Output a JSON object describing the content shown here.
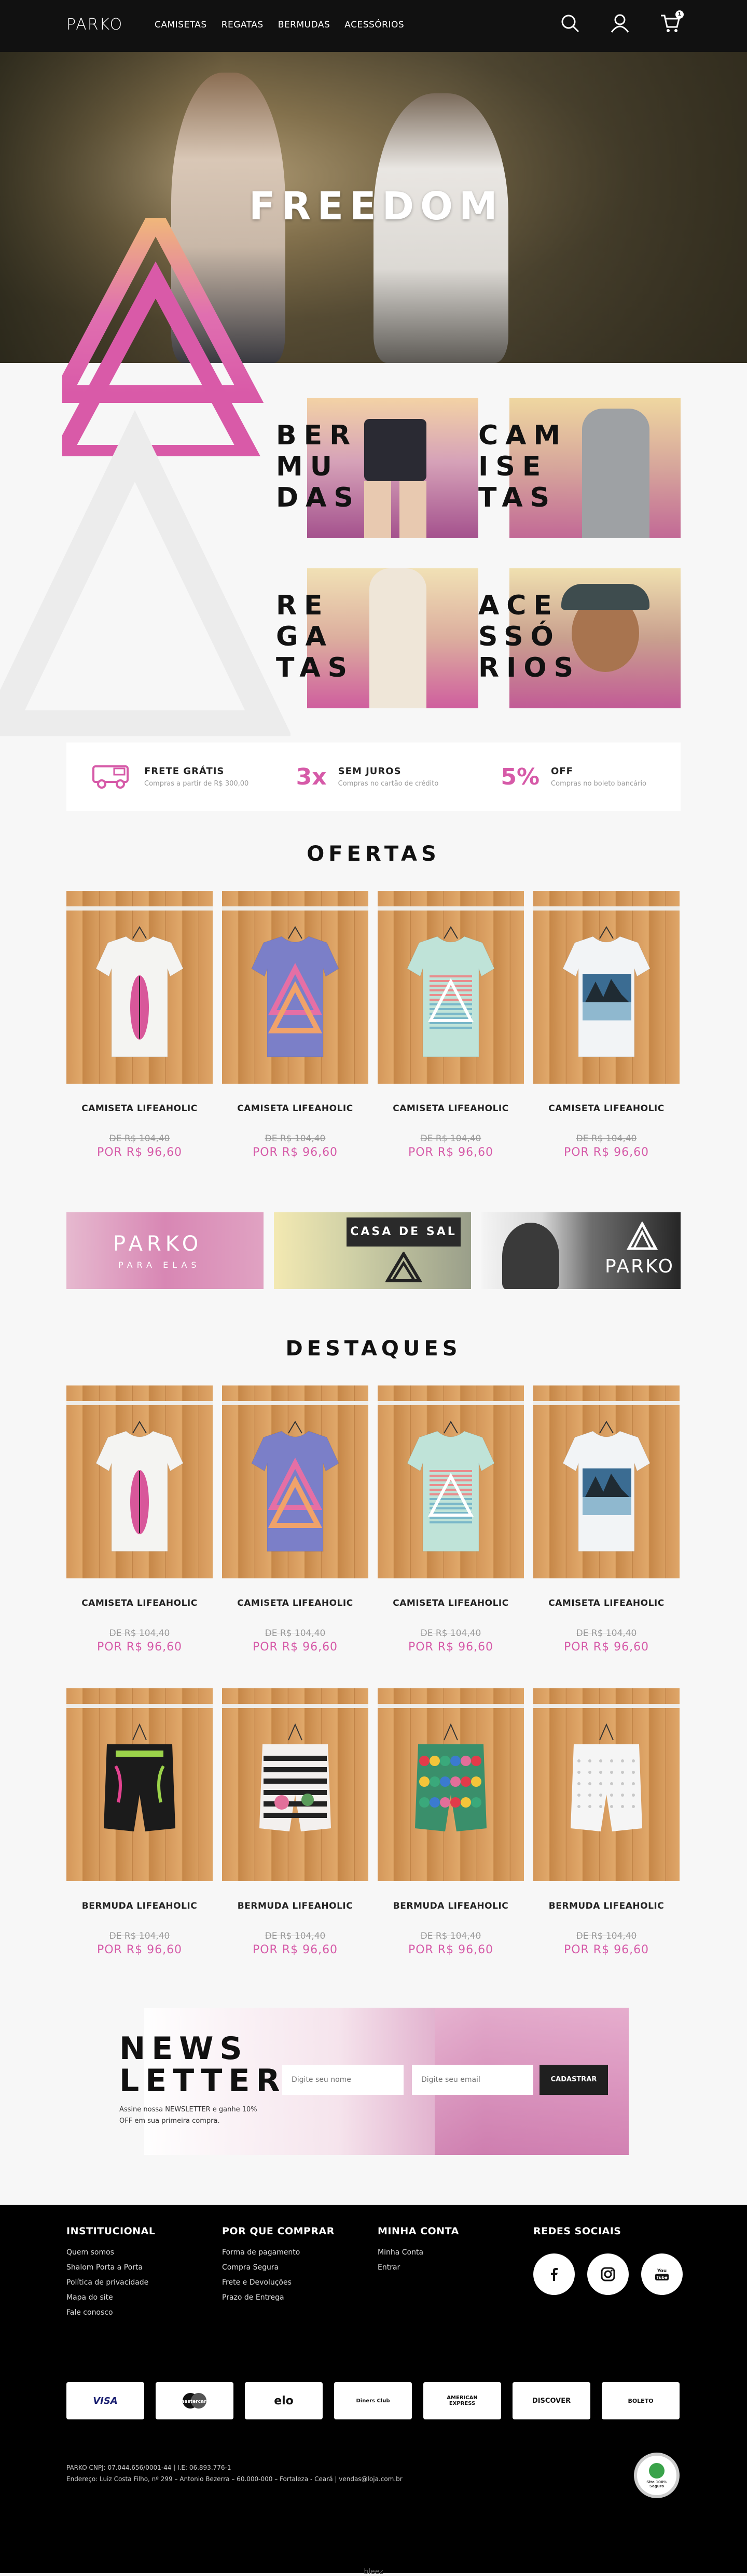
{
  "brand": {
    "logo": "PARKO",
    "accent": "#d65aa8"
  },
  "header": {
    "nav": [
      "CAMISETAS",
      "REGATAS",
      "BERMUDAS",
      "ACESSÓRIOS"
    ],
    "cart_count": "1"
  },
  "hero": {
    "title": "FREEDOM",
    "slides": 3,
    "active_slide": 1
  },
  "categories": [
    {
      "label": "BER\nMU\nDAS"
    },
    {
      "label": "CAM\nISE\nTAS"
    },
    {
      "label": "RE\nGA\nTAS"
    },
    {
      "label": "ACE\nSSÓ\nRIOS"
    }
  ],
  "benefits": [
    {
      "title": "FRETE GRÁTIS",
      "subtitle": "Compras a partir de R$ 300,00",
      "icon": "truck-icon"
    },
    {
      "title": "SEM JUROS",
      "subtitle": "Compras no cartão de crédito",
      "icon_text": "3x"
    },
    {
      "title": "OFF",
      "subtitle": "Compras no boleto bancário",
      "icon_text": "5%"
    }
  ],
  "ofertas": {
    "title": "OFERTAS",
    "products": [
      {
        "name": "CAMISETA LIFEAHOLIC",
        "old_price": "DE R$ 104,40",
        "price": "POR R$ 96,60",
        "color": "#f4f4f2",
        "print": "surfboard"
      },
      {
        "name": "CAMISETA LIFEAHOLIC",
        "old_price": "DE R$ 104,40",
        "price": "POR R$ 96,60",
        "color": "#7b7fc8",
        "print": "triangle"
      },
      {
        "name": "CAMISETA LIFEAHOLIC",
        "old_price": "DE R$ 104,40",
        "price": "POR R$ 96,60",
        "color": "#bfe3d8",
        "print": "triangle-lines"
      },
      {
        "name": "CAMISETA LIFEAHOLIC",
        "old_price": "DE R$ 104,40",
        "price": "POR R$ 96,60",
        "color": "#f2f4f6",
        "print": "photo"
      }
    ]
  },
  "banners": [
    {
      "title": "PARKO",
      "subtitle": "PARA ELAS"
    },
    {
      "title": "CASA DE SAL"
    },
    {
      "title": "PARKO"
    }
  ],
  "destaques": {
    "title": "DESTAQUES",
    "products": [
      {
        "name": "CAMISETA LIFEAHOLIC",
        "old_price": "DE R$ 104,40",
        "price": "POR R$ 96,60",
        "color": "#f4f4f2",
        "print": "surfboard"
      },
      {
        "name": "CAMISETA LIFEAHOLIC",
        "old_price": "DE R$ 104,40",
        "price": "POR R$ 96,60",
        "color": "#7b7fc8",
        "print": "triangle"
      },
      {
        "name": "CAMISETA LIFEAHOLIC",
        "old_price": "DE R$ 104,40",
        "price": "POR R$ 96,60",
        "color": "#bfe3d8",
        "print": "triangle-lines"
      },
      {
        "name": "CAMISETA LIFEAHOLIC",
        "old_price": "DE R$ 104,40",
        "price": "POR R$ 96,60",
        "color": "#f2f4f6",
        "print": "photo"
      },
      {
        "name": "BERMUDA LIFEAHOLIC",
        "old_price": "DE R$ 104,40",
        "price": "POR R$ 96,60",
        "color": "#1b1b1b",
        "print": "shorts-black"
      },
      {
        "name": "BERMUDA LIFEAHOLIC",
        "old_price": "DE R$ 104,40",
        "price": "POR R$ 96,60",
        "color": "#f3f0ee",
        "print": "shorts-stripes"
      },
      {
        "name": "BERMUDA LIFEAHOLIC",
        "old_price": "DE R$ 104,40",
        "price": "POR R$ 96,60",
        "color": "#3a8f6b",
        "print": "shorts-colorful"
      },
      {
        "name": "BERMUDA LIFEAHOLIC",
        "old_price": "DE R$ 104,40",
        "price": "POR R$ 96,60",
        "color": "#f5f5f5",
        "print": "shorts-white"
      }
    ]
  },
  "newsletter": {
    "title": "NEWS\nLETTER",
    "text": "Assine nossa NEWSLETTER e ganhe 10% OFF em sua primeira compra.",
    "name_placeholder": "Digite seu nome",
    "email_placeholder": "Digite seu email",
    "button": "CADASTRAR"
  },
  "footer": {
    "columns": [
      {
        "title": "INSTITUCIONAL",
        "links": [
          "Quem somos",
          "Shalom Porta a Porta",
          "Política de privacidade",
          "Mapa do site",
          "Fale conosco"
        ]
      },
      {
        "title": "POR QUE COMPRAR",
        "links": [
          "Forma de pagamento",
          "Compra Segura",
          "Frete e Devoluções",
          "Prazo de Entrega"
        ]
      },
      {
        "title": "MINHA CONTA",
        "links": [
          "Minha Conta",
          "Entrar"
        ]
      },
      {
        "title": "REDES SOCIAIS",
        "links": []
      }
    ],
    "social": [
      "facebook-icon",
      "instagram-icon",
      "youtube-icon"
    ],
    "payments": [
      "VISA",
      "mastercard",
      "elo",
      "Diners Club",
      "AMERICAN EXPRESS",
      "DISCOVER",
      "BOLETO"
    ],
    "legal_1": "PARKO CNPJ: 07.044.656/0001-44 | I.E: 06.893.776-1",
    "legal_2": "Endereço: Luiz Costa Filho, nº 299 – Antonio Bezerra – 60.000-000 – Fortaleza - Ceará | vendas@loja.com.br",
    "seal": "Site 100% Seguro"
  },
  "credit": "bleez"
}
